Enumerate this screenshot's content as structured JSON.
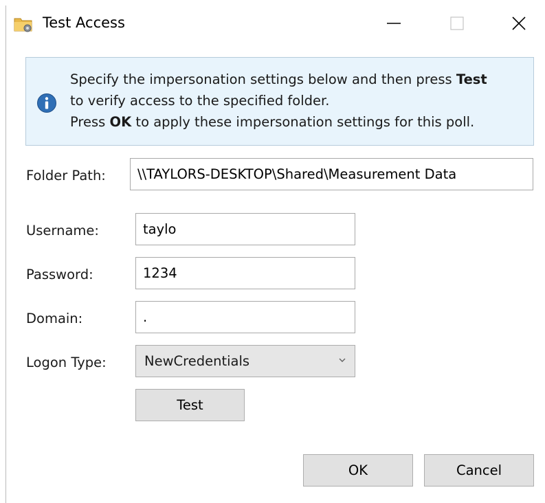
{
  "window": {
    "title": "Test Access",
    "title_icon": "folder-gear-icon"
  },
  "title_controls": {
    "minimize_icon": "minimize-icon",
    "maximize_icon": "maximize-icon",
    "close_icon": "close-icon"
  },
  "info": {
    "icon": "info-icon",
    "line1_prefix": "Specify the impersonation settings below and then press ",
    "line1_bold": "Test",
    "line2": "to verify access to the specified folder.",
    "line3_prefix": "Press ",
    "line3_bold": "OK",
    "line3_suffix": " to apply these impersonation settings for this poll."
  },
  "form": {
    "folder_path_label": "Folder Path:",
    "folder_path_value": "\\\\TAYLORS-DESKTOP\\Shared\\Measurement Data",
    "username_label": "Username:",
    "username_value": "taylo",
    "password_label": "Password:",
    "password_value": "1234",
    "domain_label": "Domain:",
    "domain_value": ".",
    "logon_type_label": "Logon Type:",
    "logon_type_value": "NewCredentials"
  },
  "buttons": {
    "test": "Test",
    "ok": "OK",
    "cancel": "Cancel"
  },
  "colors": {
    "info_bg": "#e8f4fc",
    "info_icon": "#2f6fb6",
    "button_bg": "#e1e1e1"
  }
}
